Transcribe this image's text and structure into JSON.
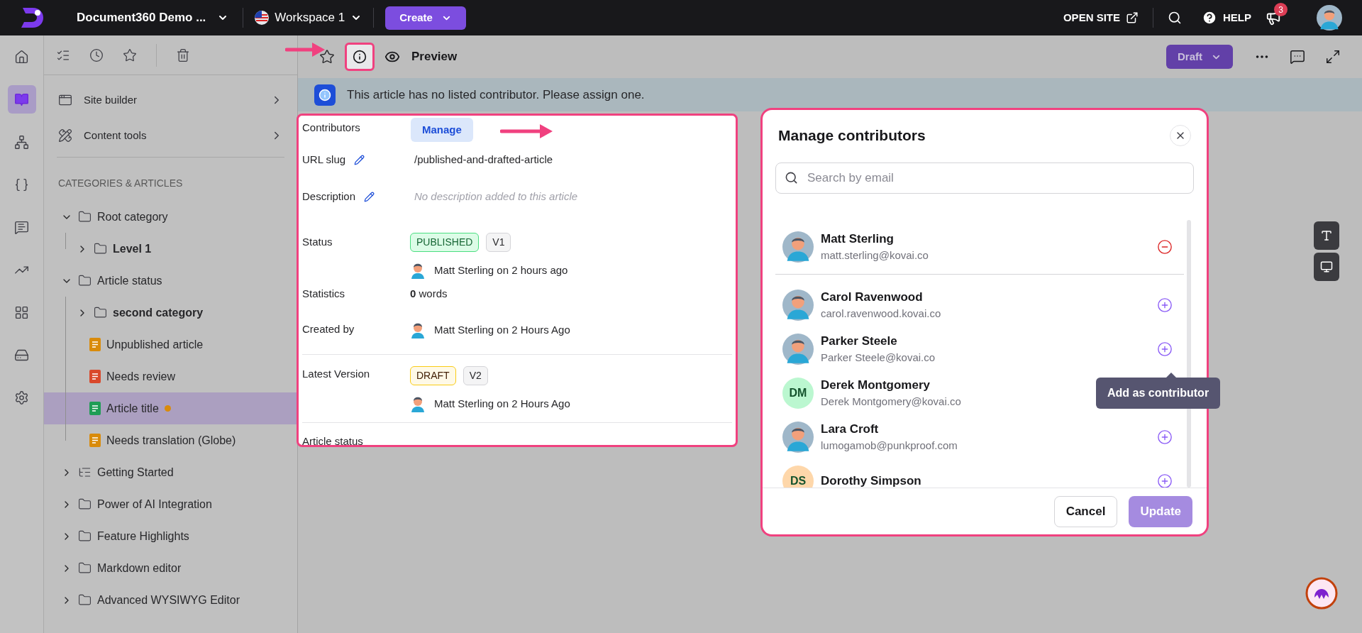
{
  "topbar": {
    "project": "Document360 Demo ...",
    "workspace": "Workspace 1",
    "create": "Create",
    "open_site": "OPEN SITE",
    "help": "HELP",
    "notifications": "3"
  },
  "rail": [
    {
      "selected": false
    },
    {
      "selected": true
    },
    {
      "selected": false
    },
    {
      "selected": false
    },
    {
      "selected": false
    },
    {
      "selected": false
    },
    {
      "selected": false
    },
    {
      "selected": false
    },
    {
      "selected": false
    }
  ],
  "sidebar": {
    "menu": [
      {
        "label": "Site builder"
      },
      {
        "label": "Content tools"
      }
    ],
    "section_title": "CATEGORIES & ARTICLES",
    "tree": [
      {
        "label": "Root category",
        "kind": "folder",
        "expanded": true,
        "selected": false,
        "children": [
          {
            "label": "Level 1",
            "kind": "folder",
            "expanded": false,
            "selected": false
          }
        ]
      },
      {
        "label": "Article status",
        "kind": "folder",
        "expanded": true,
        "selected": false,
        "children": [
          {
            "label": "second category",
            "kind": "folder",
            "expanded": false,
            "selected": false
          },
          {
            "label": "Unpublished article",
            "kind": "article",
            "color": "#d98b0b",
            "modified": false,
            "selected": false
          },
          {
            "label": "Needs review",
            "kind": "article",
            "color": "#d9482b",
            "modified": false,
            "selected": false
          },
          {
            "label": "Article title",
            "kind": "article",
            "color": "#1f9d55",
            "modified": true,
            "selected": true
          },
          {
            "label": "Needs translation (Globe)",
            "kind": "article",
            "color": "#d98b0b",
            "modified": false,
            "selected": false
          }
        ]
      },
      {
        "label": "Getting Started",
        "kind": "outline",
        "expanded": false,
        "selected": false
      },
      {
        "label": "Power of AI Integration",
        "kind": "folder",
        "expanded": false,
        "selected": false
      },
      {
        "label": "Feature Highlights",
        "kind": "folder",
        "expanded": false,
        "selected": false
      },
      {
        "label": "Markdown editor",
        "kind": "folder",
        "expanded": false,
        "selected": false
      },
      {
        "label": "Advanced WYSIWYG Editor",
        "kind": "folder",
        "expanded": false,
        "selected": false
      }
    ]
  },
  "editor": {
    "preview": "Preview",
    "status_button": "Draft",
    "banner": "This article has no listed contributor. Please assign one."
  },
  "info_panel": {
    "contributors_label": "Contributors",
    "manage": "Manage",
    "url_slug_label": "URL slug",
    "url_slug": "/published-and-drafted-article",
    "description_label": "Description",
    "description_placeholder": "No description added to this article",
    "status_label": "Status",
    "status_badges": [
      {
        "label": "PUBLISHED",
        "kind": "published"
      },
      {
        "label": "V1",
        "kind": "version"
      }
    ],
    "status_author": "Matt Sterling on 2 hours ago",
    "statistics_label": "Statistics",
    "statistics": "**0** words",
    "created_by_label": "Created by",
    "created_by": "Matt Sterling on 2 Hours Ago",
    "latest_version_label": "Latest Version",
    "latest_badges": [
      {
        "label": "DRAFT",
        "kind": "draft"
      },
      {
        "label": "V2",
        "kind": "version"
      }
    ],
    "latest_author": "Matt Sterling on 2 Hours Ago",
    "article_status_label": "Article status"
  },
  "modal": {
    "title": "Manage contributors",
    "search_placeholder": "Search by email",
    "contributors": [
      {
        "name": "Matt Sterling",
        "email": "matt.sterling@kovai.co",
        "kind": "figure",
        "added": true
      },
      {
        "name": "Carol Ravenwood",
        "email": "carol.ravenwood.kovai.co",
        "kind": "figure",
        "added": false
      },
      {
        "name": "Parker Steele",
        "email": "Parker Steele@kovai.co",
        "kind": "figure",
        "added": false
      },
      {
        "name": "Derek Montgomery",
        "email": "Derek Montgomery@kovai.co",
        "kind": "initials",
        "initials": "DM",
        "color": "#bbf7d0"
      },
      {
        "name": "Lara Croft",
        "email": "lumogamob@punkproof.com",
        "kind": "figure",
        "added": false
      },
      {
        "name": "Dorothy Simpson",
        "kind": "initials",
        "initials": "DS",
        "color": "#fed7aa",
        "added": false
      }
    ],
    "tooltip": "Add as contributor",
    "cancel": "Cancel",
    "update": "Update",
    "update_disabled": true
  }
}
